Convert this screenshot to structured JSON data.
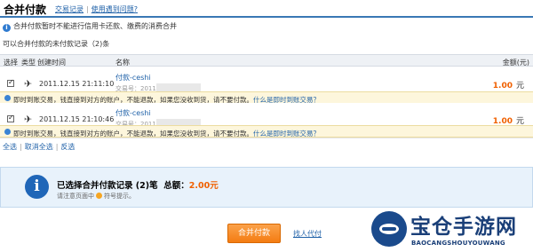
{
  "header": {
    "title": "合并付款",
    "link_records": "交易记录",
    "separator": "|",
    "link_help": "使用遇到问题?"
  },
  "notice": {
    "icon": "info-icon",
    "text": "合并付款暂时不能进行信用卡还款、缴费的消费合并"
  },
  "summary": "可以合并付款的未付款记录（2)条",
  "table": {
    "columns": {
      "select": "选择",
      "type": "类型",
      "created": "创建时间",
      "name": "名称",
      "amount": "金额(元)"
    },
    "rows": [
      {
        "checked": true,
        "type_icon": "handshake-icon",
        "time": "2011.12.15 21:11:10",
        "name": "付款-ceshi",
        "trade_no": "交易号：2011",
        "amount": "1.00",
        "unit": "元",
        "tip": "即时到账交易，钱直接到对方的账户，不能退款，如果您没收到货，请不要付款。",
        "tip_link": "什么是即时到账交易？"
      },
      {
        "checked": true,
        "type_icon": "handshake-icon",
        "time": "2011.12.15 21:10:46",
        "name": "付款-ceshi",
        "trade_no": "交易号：2011",
        "amount": "1.00",
        "unit": "元",
        "tip": "即时到账交易，钱直接到对方的账户，不能退款，如果您没收到货，请不要付款。",
        "tip_link": "什么是即时到账交易？"
      }
    ]
  },
  "actions": {
    "select_all": "全选",
    "deselect_all": "取消全选",
    "invert": "反选",
    "sep": "|"
  },
  "panel": {
    "icon": "info-icon",
    "selected_prefix": "已选择合并付款记录 (2)笔",
    "total_label": "总额：",
    "total_value": "2.00元",
    "note_before": "请注意页面中",
    "note_after": "符号提示。"
  },
  "buttons": {
    "pay": "合并付款",
    "proxy": "找人代付"
  },
  "watermark": {
    "cn": "宝仓手游网",
    "en": "BAOCANGSHOUYOUWANG"
  },
  "colors": {
    "accent_blue": "#1f61a8",
    "amount_orange": "#f06000",
    "button_orange": "#f47c12"
  }
}
